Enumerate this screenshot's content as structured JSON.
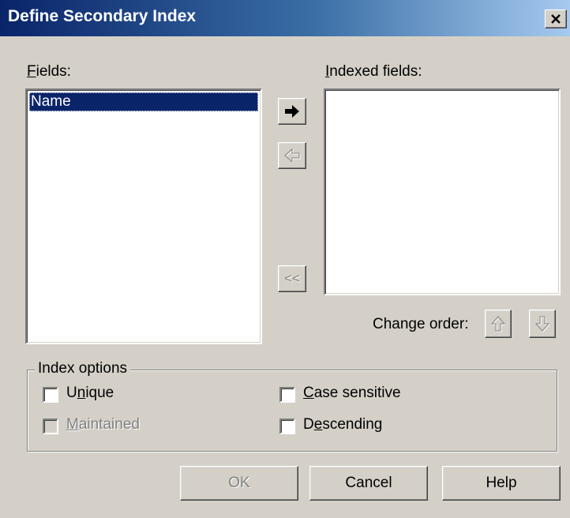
{
  "dialog": {
    "title": "Define Secondary Index",
    "close_icon": "close-icon"
  },
  "fields": {
    "label_accel": "F",
    "label_rest": "ields:",
    "items": [
      "Name"
    ],
    "selected_index": 0
  },
  "indexed_fields": {
    "label_accel": "I",
    "label_rest": "ndexed fields:",
    "items": []
  },
  "transfer_buttons": {
    "add_icon": "arrow-right-icon",
    "remove_icon": "arrow-left-icon",
    "remove_all_label": "<<"
  },
  "change_order": {
    "label": "Change order:",
    "up_icon": "arrow-up-icon",
    "down_icon": "arrow-down-icon"
  },
  "index_options": {
    "group_label": "Index options",
    "unique": {
      "pre": "U",
      "accel": "n",
      "post": "ique",
      "checked": false,
      "enabled": true
    },
    "maintained": {
      "pre": "",
      "accel": "M",
      "post": "aintained",
      "checked": false,
      "enabled": false
    },
    "case_sensitive": {
      "pre": "",
      "accel": "C",
      "post": "ase sensitive",
      "checked": false,
      "enabled": true
    },
    "descending": {
      "pre": "D",
      "accel": "e",
      "post": "scending",
      "checked": false,
      "enabled": true
    }
  },
  "buttons": {
    "ok_label": "OK",
    "cancel_label": "Cancel",
    "help_label": "Help"
  },
  "colors": {
    "face": "#d4d0c8",
    "title_start": "#0a246a",
    "title_end": "#a6caf0",
    "selection": "#0a246a"
  }
}
